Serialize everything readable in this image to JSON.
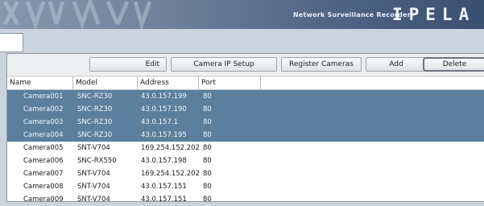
{
  "header": {
    "subtitle": "Network Surveillance Recorder",
    "logo": "IPELA"
  },
  "toolbar": {
    "edit_label": "Edit",
    "camera_ip_setup_label": "Camera IP Setup",
    "register_cameras_label": "Register Cameras",
    "add_label": "Add",
    "delete_label": "Delete"
  },
  "table": {
    "columns": [
      "Name",
      "Model",
      "Address",
      "Port"
    ],
    "rows": [
      {
        "name": "Camera001",
        "model": "SNC-RZ30",
        "address": "43.0.157.199",
        "port": "80",
        "selected": true
      },
      {
        "name": "Camera002",
        "model": "SNC-RZ30",
        "address": "43.0.157.190",
        "port": "80",
        "selected": true
      },
      {
        "name": "Camera003",
        "model": "SNC-RZ30",
        "address": "43.0.157.1",
        "port": "80",
        "selected": true
      },
      {
        "name": "Camera004",
        "model": "SNC-RZ30",
        "address": "43.0.157.195",
        "port": "80",
        "selected": true
      },
      {
        "name": "Camera005",
        "model": "SNT-V704",
        "address": "169.254.152.202",
        "port": "80",
        "selected": false
      },
      {
        "name": "Camera006",
        "model": "SNC-RX550",
        "address": "43.0.157.198",
        "port": "80",
        "selected": false
      },
      {
        "name": "Camera007",
        "model": "SNT-V704",
        "address": "169.254.152.202",
        "port": "80",
        "selected": false
      },
      {
        "name": "Camera008",
        "model": "SNT-V704",
        "address": "43.0.157.151",
        "port": "80",
        "selected": false
      },
      {
        "name": "Camera009",
        "model": "SNT-V704",
        "address": "43.0.157.151",
        "port": "80",
        "selected": false
      }
    ]
  },
  "colors": {
    "selected_row": "#5b7f9c",
    "banner_dark": "#3b4f72"
  }
}
